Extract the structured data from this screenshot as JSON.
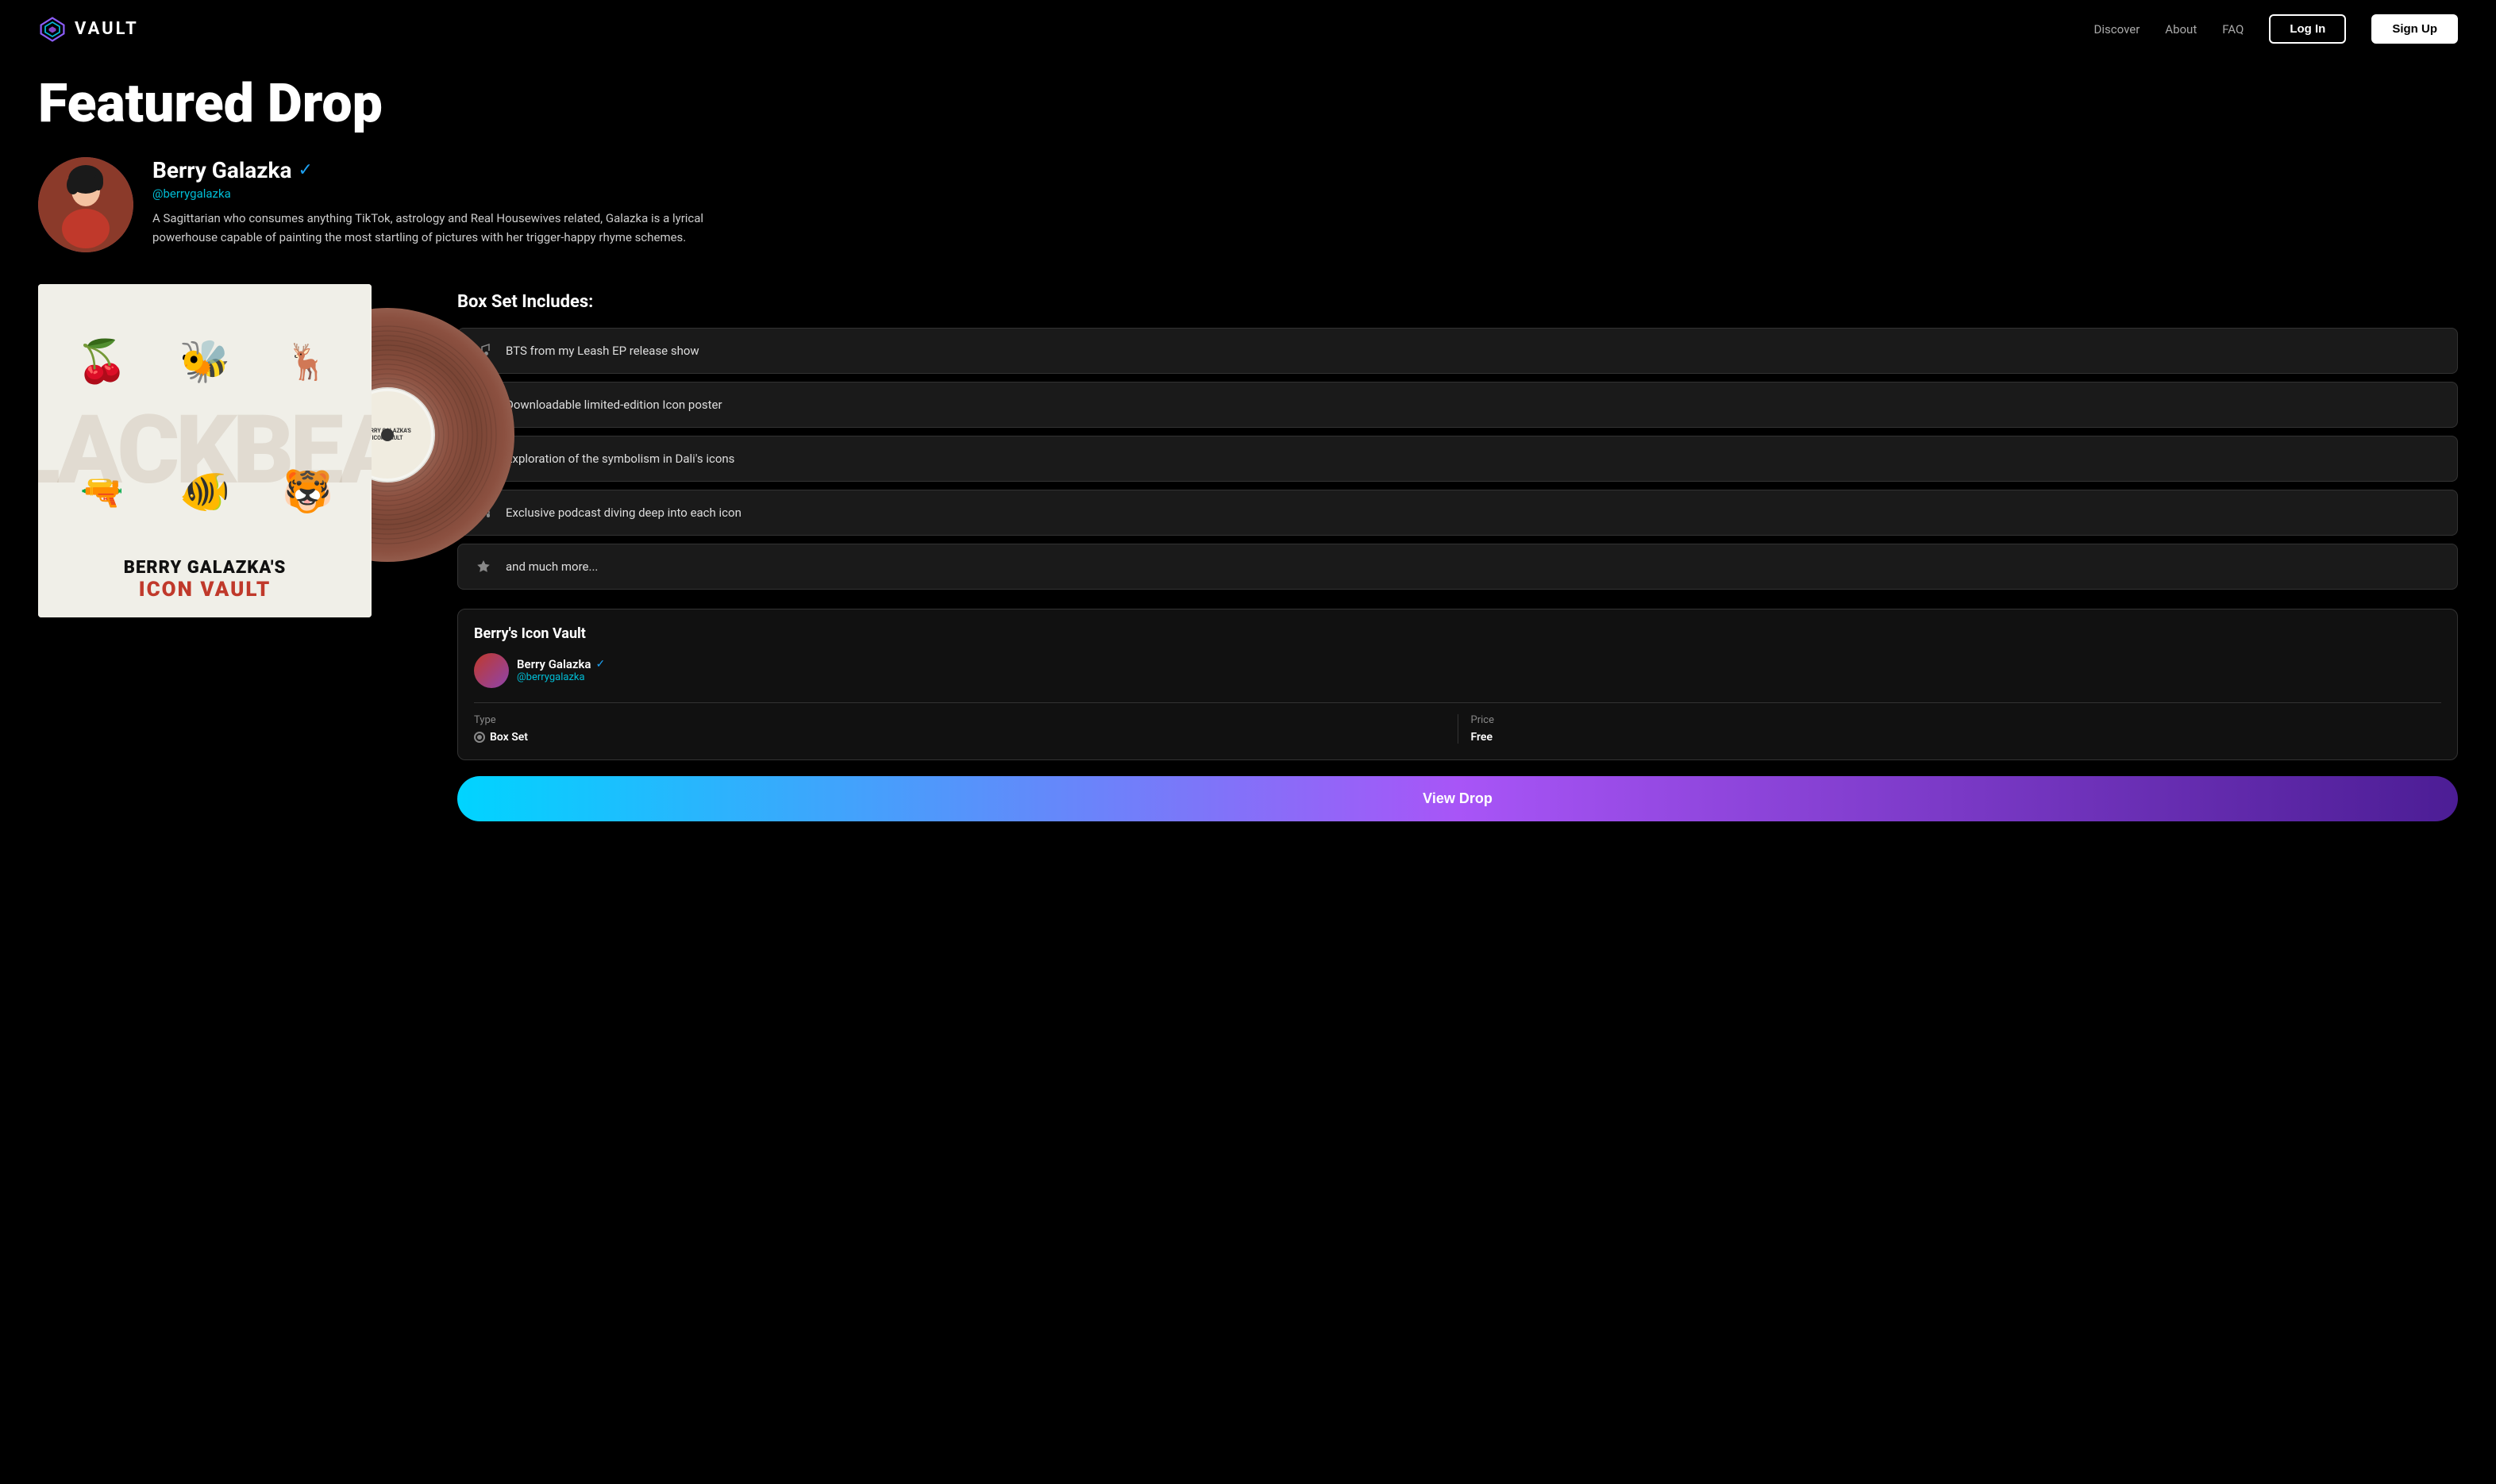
{
  "nav": {
    "logo_text": "VAULT",
    "links": [
      {
        "label": "Discover",
        "id": "discover"
      },
      {
        "label": "About",
        "id": "about"
      },
      {
        "label": "FAQ",
        "id": "faq"
      }
    ],
    "login_label": "Log In",
    "signup_label": "Sign Up"
  },
  "hero": {
    "title": "Featured Drop"
  },
  "artist": {
    "name": "Berry Galazka",
    "handle": "@berrygalazka",
    "bio": "A Sagittarian who consumes anything TikTok, astrology and Real Housewives related, Galazka is a lyrical powerhouse capable of painting the most startling of pictures with her trigger-happy rhyme schemes."
  },
  "album": {
    "title_line1": "BERRY GALAZKA'S",
    "title_line2": "ICON VAULT",
    "vinyl_label_line1": "BERRY GALAZKA'S",
    "vinyl_label_line2": "ICON VAULT",
    "watermark": "BLACKBEAR"
  },
  "box_set": {
    "section_title": "Box Set Includes:",
    "items": [
      {
        "icon": "music",
        "label": "BTS from my Leash EP release show"
      },
      {
        "icon": "image",
        "label": "Downloadable limited-edition Icon poster"
      },
      {
        "icon": "headphones",
        "label": "Exploration of the symbolism in Dali's icons"
      },
      {
        "icon": "headphones",
        "label": "Exclusive podcast diving deep into each icon"
      },
      {
        "icon": "star",
        "label": "and much more..."
      }
    ]
  },
  "vault_card": {
    "title": "Berry's Icon Vault",
    "artist_name": "Berry Galazka",
    "artist_handle": "@berrygalazka",
    "type_label": "Type",
    "type_value": "Box Set",
    "price_label": "Price",
    "price_value": "Free"
  },
  "cta": {
    "label": "View Drop"
  }
}
